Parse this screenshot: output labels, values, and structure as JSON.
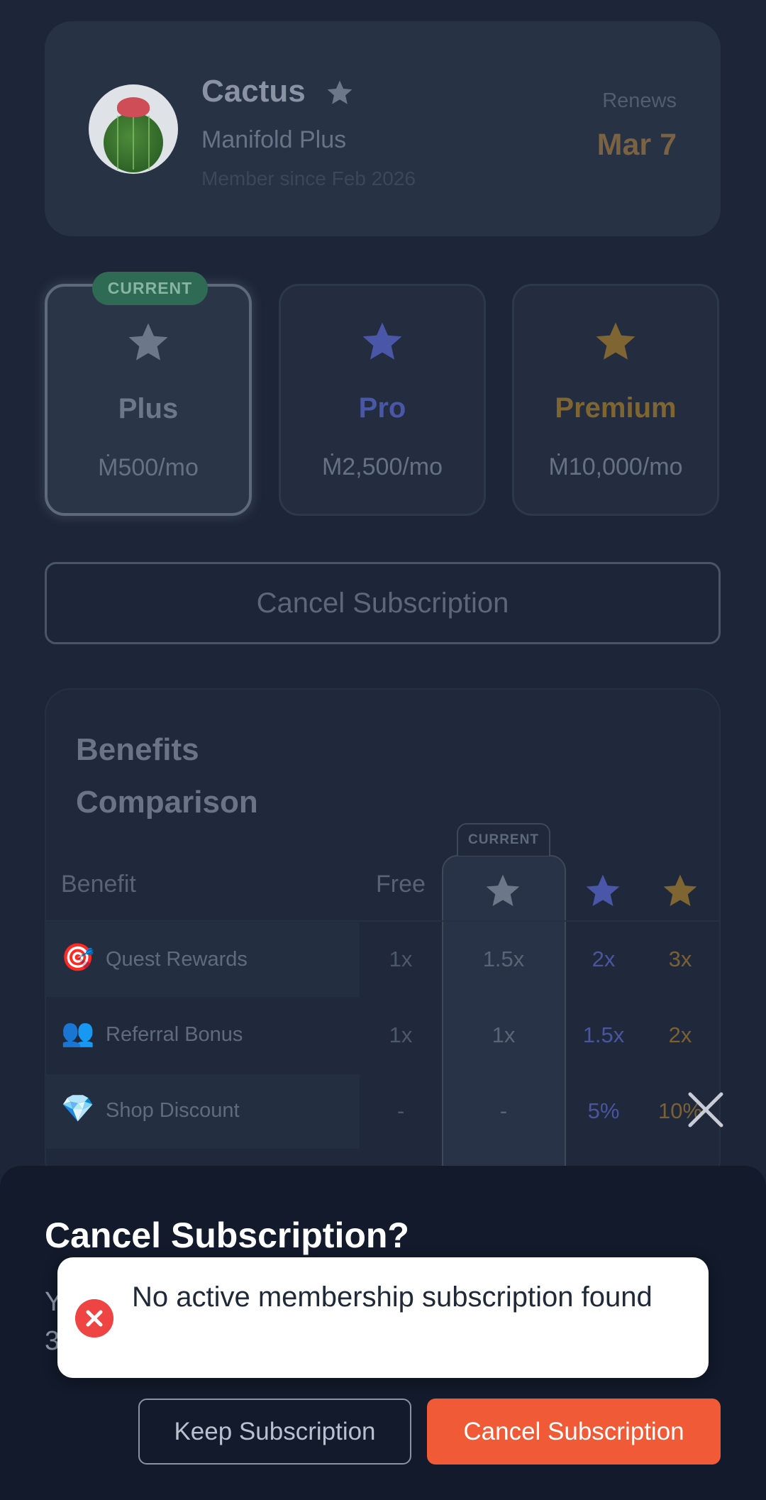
{
  "profile": {
    "name": "Cactus",
    "plan": "Manifold Plus",
    "member_since": "Member since Feb 2026",
    "renews_label": "Renews",
    "renews_date": "Mar 7"
  },
  "plans": [
    {
      "title": "Plus",
      "price": "Ṁ500/mo",
      "color": "#6c778a",
      "current": true
    },
    {
      "title": "Pro",
      "price": "Ṁ2,500/mo",
      "color": "#4a56a8",
      "current": false
    },
    {
      "title": "Premium",
      "price": "Ṁ10,000/mo",
      "color": "#7f6532",
      "current": false
    }
  ],
  "current_badge": "CURRENT",
  "cancel_button": "Cancel Subscription",
  "benefits": {
    "title": "Benefits Comparison",
    "current_badge": "CURRENT",
    "header_benefit": "Benefit",
    "header_free": "Free",
    "rows": [
      {
        "icon": "🎯",
        "label": "Quest Rewards",
        "free": "1x",
        "plus": "1.5x",
        "pro": "2x",
        "premium": "3x"
      },
      {
        "icon": "👥",
        "label": "Referral Bonus",
        "free": "1x",
        "plus": "1x",
        "pro": "1.5x",
        "premium": "2x"
      },
      {
        "icon": "💎",
        "label": "Shop Discount",
        "free": "-",
        "plus": "-",
        "pro": "5%",
        "premium": "10%"
      }
    ]
  },
  "sheet": {
    "title": "Cancel Subscription?",
    "body_line1": "Y",
    "body_line2": "3",
    "keep_button": "Keep Subscription",
    "confirm_button": "Cancel Subscription"
  },
  "toast": {
    "message": "No active membership subscription found"
  },
  "colors": {
    "background": "#1c2638",
    "accent_orange": "#f15a36",
    "error_red": "#ef4444",
    "badge_green": "#2f6a54"
  }
}
